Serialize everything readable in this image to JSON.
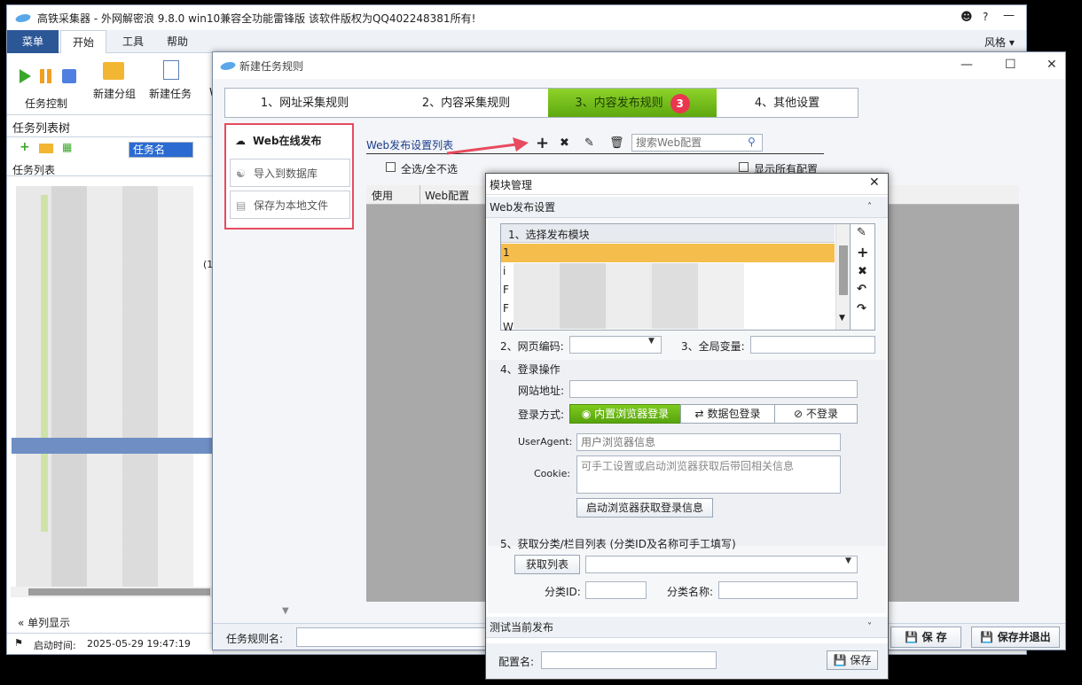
{
  "main": {
    "title": "高铁采集器 - 外网解密浪 9.8.0 win10兼容全功能雷锋版  该软件版权为QQ402248381所有!",
    "menu": {
      "caidan": "菜单",
      "kaishi": "开始",
      "gongju": "工具",
      "bangzhu": "帮助",
      "style": "风格"
    },
    "ribbon": {
      "task_control": "任务控制",
      "new_group": "新建分组",
      "new_task": "新建任务",
      "w": "W"
    },
    "tree": {
      "title": "任务列表树",
      "combo_value": "任务名",
      "list_label": "任务列表",
      "suffix": "(1"
    },
    "footer": {
      "single_column": "单列显示",
      "start_time_label": "启动时间:",
      "start_time": "2025-05-29 19:47:19"
    }
  },
  "task": {
    "title": "新建任务规则",
    "steps": [
      "1、网址采集规则",
      "2、内容采集规则",
      "3、内容发布规则",
      "4、其他设置"
    ],
    "active_badge": "3",
    "side": {
      "web_publish": "Web在线发布",
      "import_db": "导入到数据库",
      "save_local": "保存为本地文件"
    },
    "list_title": "Web发布设置列表",
    "search_placeholder": "搜索Web配置",
    "select_all": "全选/全不选",
    "show_all": "显示所有配置",
    "columns": [
      "使用",
      "Web配置"
    ],
    "rule_name_label": "任务规则名:",
    "save": "保 存",
    "save_exit": "保存并退出"
  },
  "module": {
    "title": "模块管理",
    "web_settings": "Web发布设置",
    "select_module": "1、选择发布模块",
    "module_rows": [
      "1",
      "i",
      "F",
      "F",
      "W"
    ],
    "encoding_label": "2、网页编码:",
    "global_var_label": "3、全局变量:",
    "login_label": "4、登录操作",
    "site_url_label": "网站地址:",
    "login_mode_label": "登录方式:",
    "login_modes": [
      "内置浏览器登录",
      "数据包登录",
      "不登录"
    ],
    "useragent_label": "UserAgent:",
    "useragent_placeholder": "用户浏览器信息",
    "cookie_label": "Cookie:",
    "cookie_placeholder": "可手工设置或启动浏览器获取后带回相关信息",
    "launch_browser": "启动浏览器获取登录信息",
    "category_label": "5、获取分类/栏目列表 (分类ID及名称可手工填写)",
    "get_list": "获取列表",
    "cat_id_label": "分类ID:",
    "cat_name_label": "分类名称:",
    "test_publish": "测试当前发布",
    "config_name_label": "配置名:",
    "save": "保存"
  }
}
